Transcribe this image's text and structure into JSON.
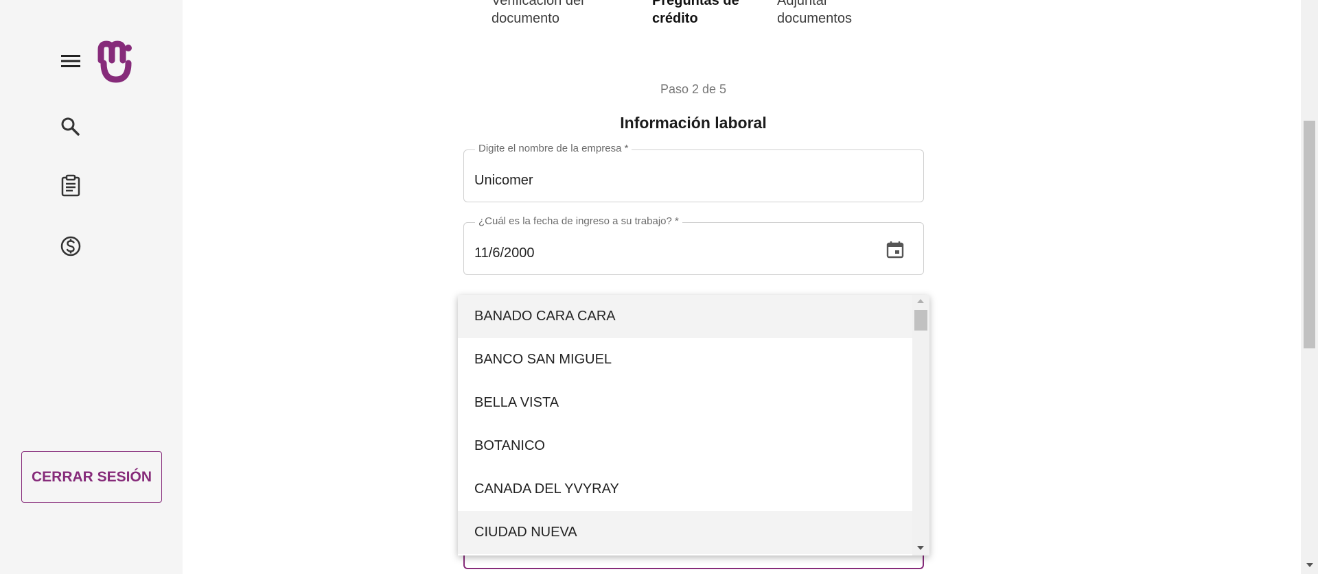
{
  "sidebar": {
    "menu_icon": "menu-icon",
    "logo_icon": "brand-logo",
    "nav_items": [
      {
        "icon": "search-icon"
      },
      {
        "icon": "clipboard-icon"
      },
      {
        "icon": "dollar-icon"
      }
    ],
    "logout_label": "CERRAR SESIÓN"
  },
  "stepper": {
    "steps": [
      {
        "line1": "Verificación del",
        "line2": "documento",
        "state": "done"
      },
      {
        "line1": "Preguntas de",
        "line2": "crédito",
        "state": "active"
      },
      {
        "line1": "Adjuntar",
        "line2": "documentos",
        "state": "pending"
      }
    ]
  },
  "form": {
    "step_counter": "Paso 2 de 5",
    "section_title": "Información laboral",
    "company": {
      "label": "Digite el nombre de la empresa *",
      "value": "Unicomer"
    },
    "start_date": {
      "label": "¿Cuál es la fecha de ingreso a su trabajo? *",
      "value": "11/6/2000",
      "icon": "calendar-icon"
    }
  },
  "dropdown": {
    "options": [
      {
        "label": "BANADO CARA CARA",
        "highlighted": true
      },
      {
        "label": "BANCO SAN MIGUEL",
        "highlighted": false
      },
      {
        "label": "BELLA VISTA",
        "highlighted": false
      },
      {
        "label": "BOTANICO",
        "highlighted": false
      },
      {
        "label": "CANADA DEL YVYRAY",
        "highlighted": false
      },
      {
        "label": "CIUDAD NUEVA",
        "highlighted": true
      }
    ]
  },
  "colors": {
    "brand": "#862b7a",
    "sidebar_bg": "#f5f5f5",
    "highlight_bg": "#f3f3f3"
  }
}
